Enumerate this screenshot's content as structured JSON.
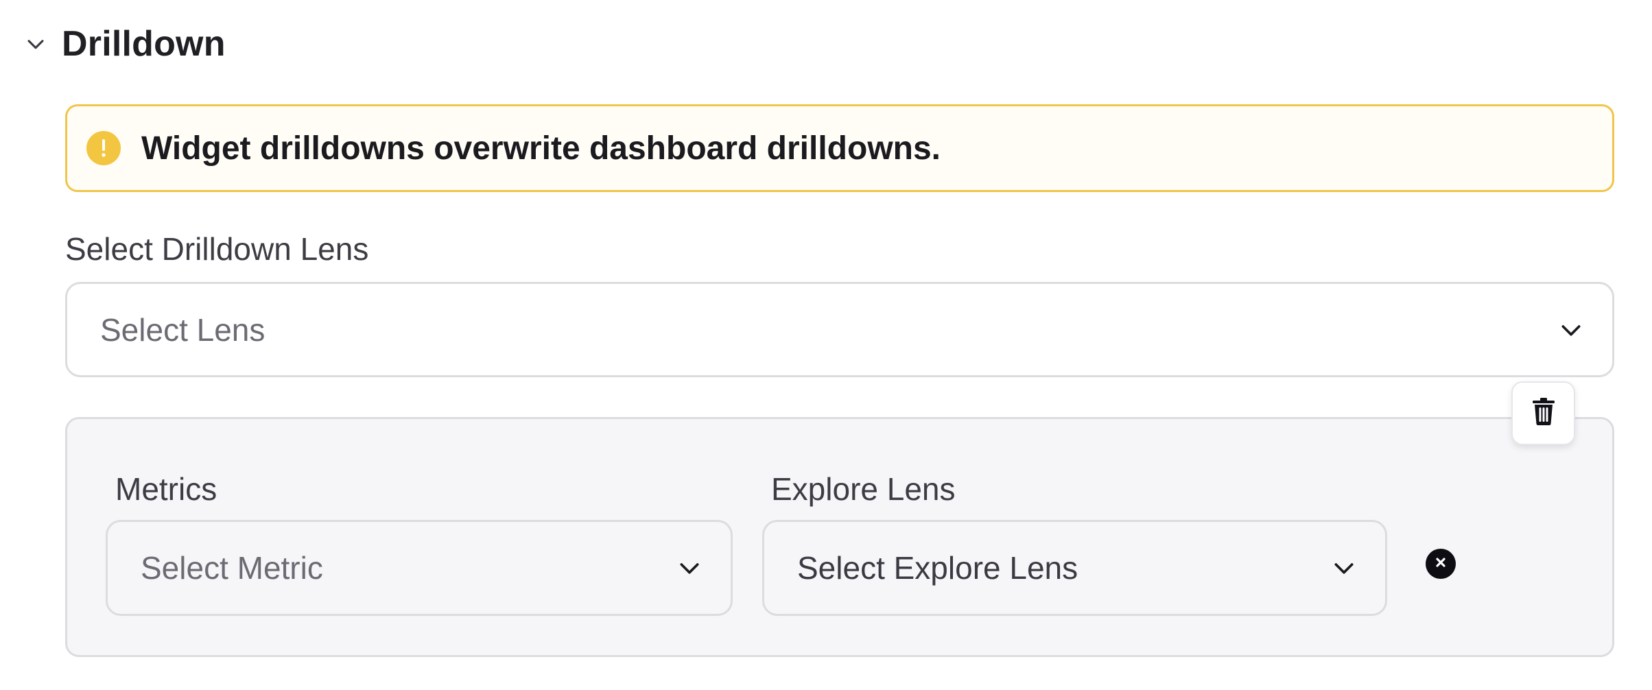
{
  "section": {
    "title": "Drilldown",
    "toggle_icon": "chevron-down-icon"
  },
  "warning": {
    "text": "Widget drilldowns overwrite dashboard drilldowns.",
    "icon": "exclamation-circle-icon",
    "accent_color": "#f2c641"
  },
  "drilldown_lens": {
    "label": "Select Drilldown Lens",
    "placeholder": "Select Lens"
  },
  "mapping": {
    "metrics_label": "Metrics",
    "metrics_placeholder": "Select Metric",
    "explore_lens_label": "Explore Lens",
    "explore_lens_placeholder": "Select Explore Lens",
    "delete_icon": "trash-icon",
    "remove_icon": "close-circle-icon"
  }
}
